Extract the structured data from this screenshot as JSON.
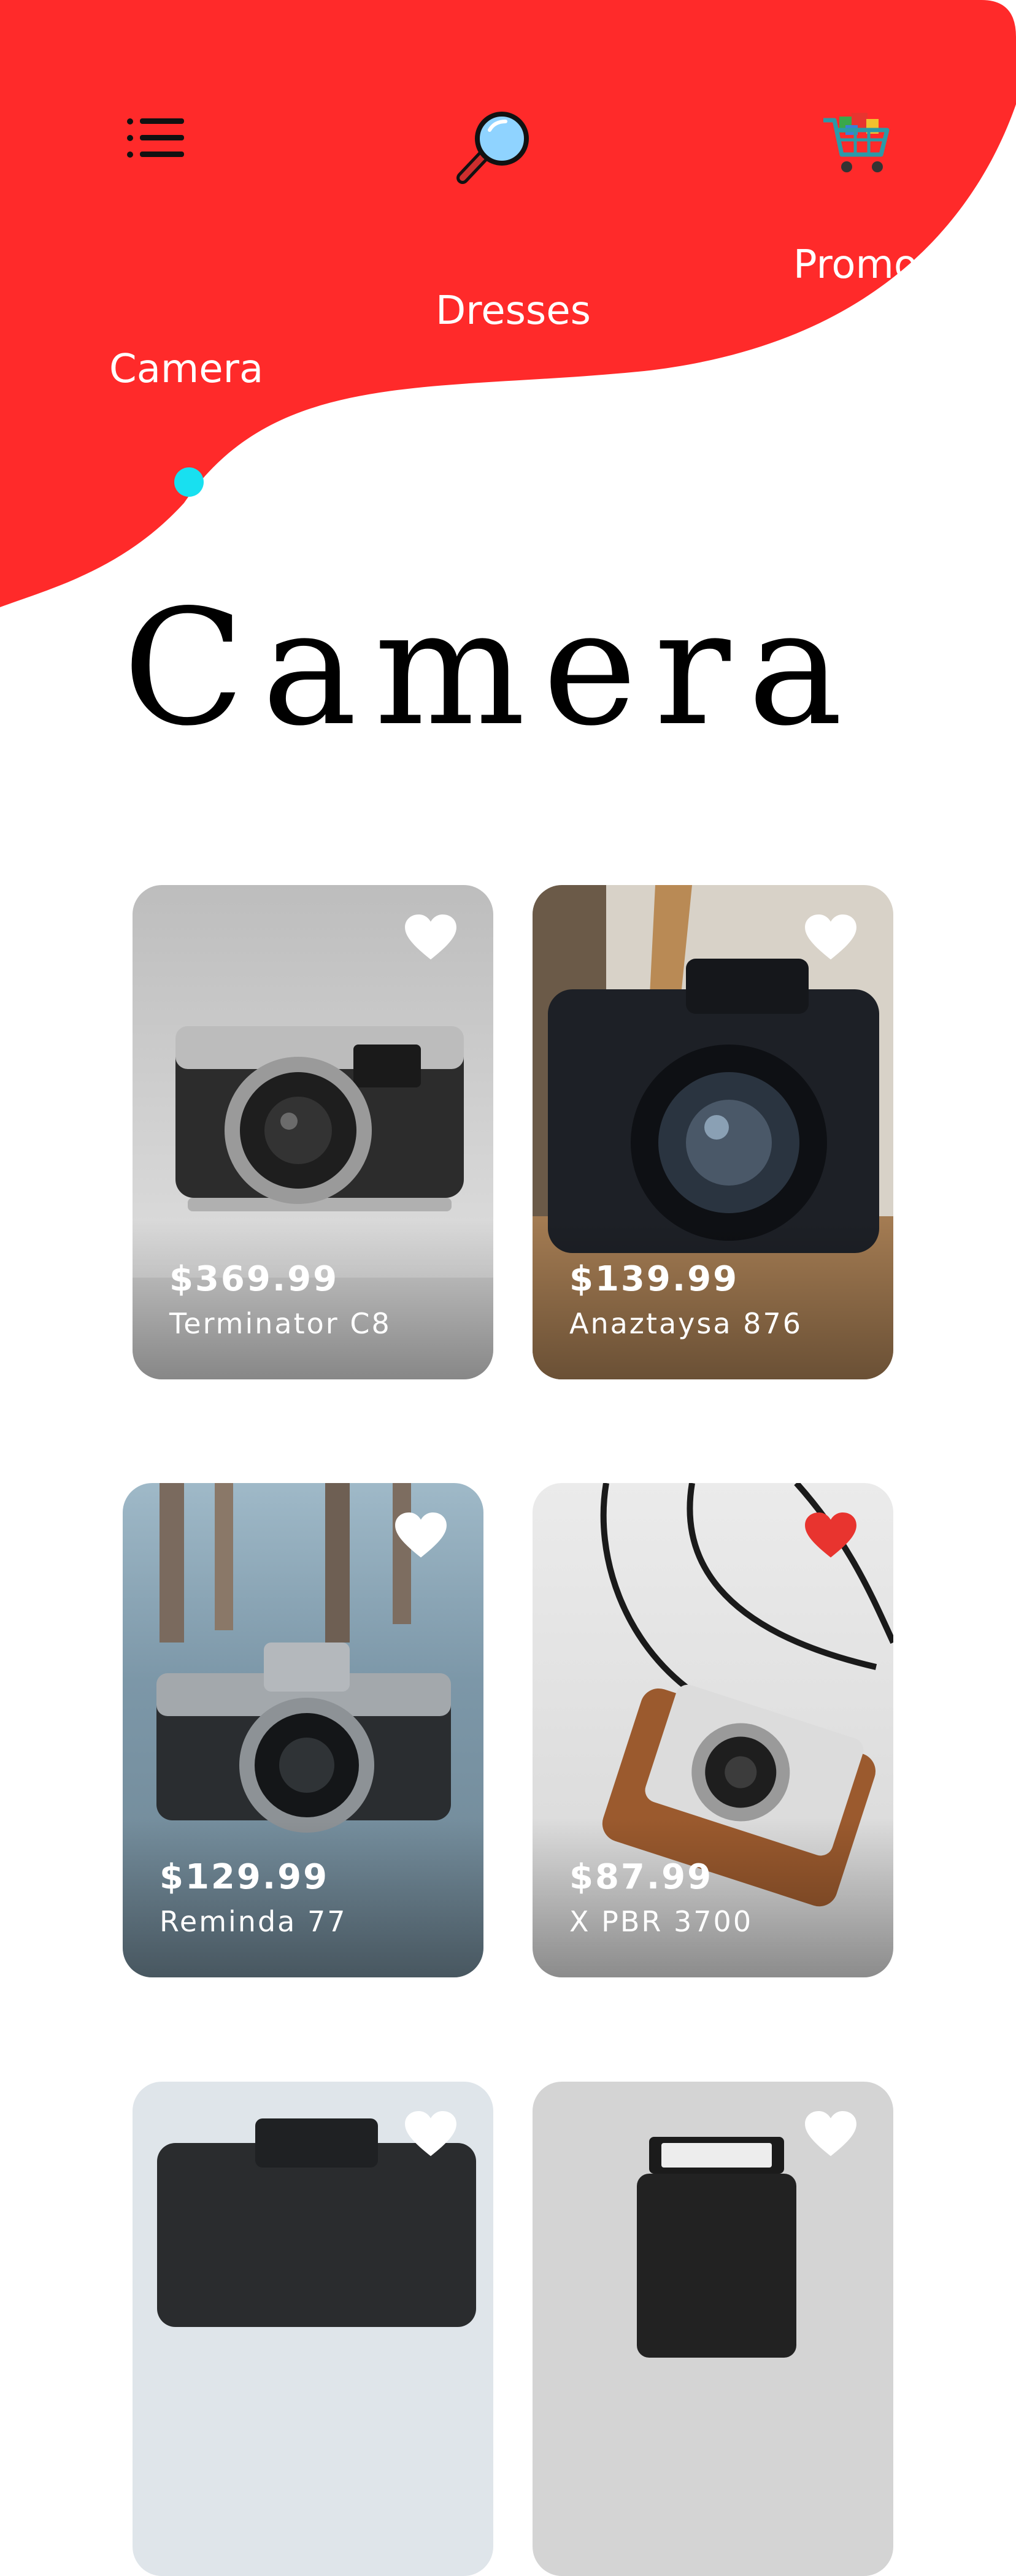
{
  "header": {
    "menu_icon": "menu-icon",
    "search_icon": "search-icon",
    "cart_icon": "shopping-cart-icon",
    "accent_color": "#ff2a2a",
    "indicator_color": "#18e0f0"
  },
  "categories": [
    {
      "label": "Camera",
      "active": true
    },
    {
      "label": "Dresses"
    },
    {
      "label": "Promo"
    }
  ],
  "page_title": "Camera",
  "products": [
    {
      "price": "$369.99",
      "name": "Terminator C8",
      "favorite": false
    },
    {
      "price": "$139.99",
      "name": "Anaztaysa 876",
      "favorite": false
    },
    {
      "price": "$129.99",
      "name": "Reminda 77",
      "favorite": false
    },
    {
      "price": "$87.99",
      "name": "X PBR 3700",
      "favorite": true
    },
    {
      "price": "",
      "name": "",
      "favorite": false
    },
    {
      "price": "",
      "name": "",
      "favorite": false
    }
  ],
  "colors": {
    "favorite_on": "#e8342f",
    "favorite_off": "#ffffff"
  }
}
